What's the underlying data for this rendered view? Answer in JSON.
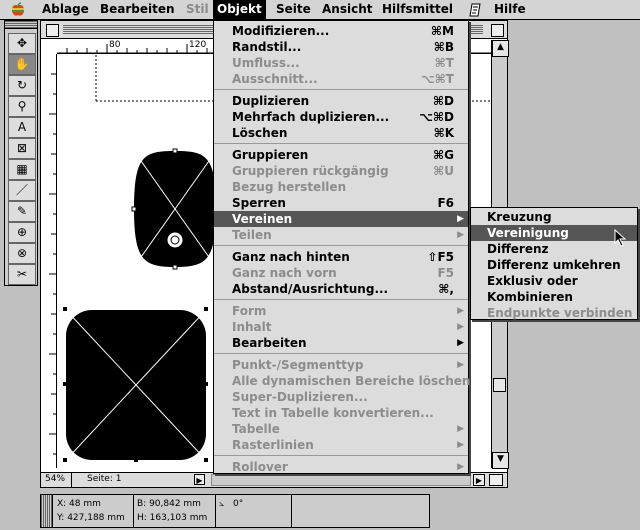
{
  "menubar": {
    "apple": "",
    "items": [
      {
        "label": "Ablage",
        "state": "normal"
      },
      {
        "label": "Bearbeiten",
        "state": "normal"
      },
      {
        "label": "Stil",
        "state": "dim"
      },
      {
        "label": "Objekt",
        "state": "active"
      },
      {
        "label": "Seite",
        "state": "normal"
      },
      {
        "label": "Ansicht",
        "state": "normal"
      },
      {
        "label": "Hilfsmittel",
        "state": "normal"
      },
      {
        "label": "Hilfe",
        "state": "normal"
      }
    ]
  },
  "ruler": {
    "mark1": "80",
    "mark2": "120"
  },
  "status": {
    "zoom": "54%",
    "page": "Seite: 1"
  },
  "objekt_menu": {
    "items": [
      {
        "label": "Modifizieren...",
        "shortcut": "⌘M",
        "dim": false
      },
      {
        "label": "Randstil...",
        "shortcut": "⌘B",
        "dim": false
      },
      {
        "label": "Umfluss...",
        "shortcut": "⌘T",
        "dim": true
      },
      {
        "label": "Ausschnitt...",
        "shortcut": "⌥⌘T",
        "dim": true
      },
      {
        "sep": true
      },
      {
        "label": "Duplizieren",
        "shortcut": "⌘D",
        "dim": false
      },
      {
        "label": "Mehrfach duplizieren...",
        "shortcut": "⌥⌘D",
        "dim": false
      },
      {
        "label": "Löschen",
        "shortcut": "⌘K",
        "dim": false
      },
      {
        "sep": true
      },
      {
        "label": "Gruppieren",
        "shortcut": "⌘G",
        "dim": false
      },
      {
        "label": "Gruppieren rückgängig",
        "shortcut": "⌘U",
        "dim": true
      },
      {
        "label": "Bezug herstellen",
        "shortcut": "",
        "dim": true
      },
      {
        "label": "Sperren",
        "shortcut": "F6",
        "dim": false
      },
      {
        "label": "Vereinen",
        "shortcut": "",
        "dim": false,
        "submenu": true,
        "highlight": true
      },
      {
        "label": "Teilen",
        "shortcut": "",
        "dim": true,
        "submenu": true
      },
      {
        "sep": true
      },
      {
        "label": "Ganz nach hinten",
        "shortcut": "⇧F5",
        "dim": false
      },
      {
        "label": "Ganz nach vorn",
        "shortcut": "F5",
        "dim": true
      },
      {
        "label": "Abstand/Ausrichtung...",
        "shortcut": "⌘,",
        "dim": false
      },
      {
        "sep": true
      },
      {
        "label": "Form",
        "shortcut": "",
        "dim": true,
        "submenu": true
      },
      {
        "label": "Inhalt",
        "shortcut": "",
        "dim": true,
        "submenu": true
      },
      {
        "label": "Bearbeiten",
        "shortcut": "",
        "dim": false,
        "submenu": true
      },
      {
        "sep": true
      },
      {
        "label": "Punkt-/Segmenttyp",
        "shortcut": "",
        "dim": true,
        "submenu": true
      },
      {
        "label": "Alle dynamischen Bereiche löschen",
        "shortcut": "",
        "dim": true
      },
      {
        "label": "Super-Duplizieren...",
        "shortcut": "",
        "dim": true
      },
      {
        "label": "Text in Tabelle konvertieren...",
        "shortcut": "",
        "dim": true
      },
      {
        "label": "Tabelle",
        "shortcut": "",
        "dim": true,
        "submenu": true
      },
      {
        "label": "Rasterlinien",
        "shortcut": "",
        "dim": true,
        "submenu": true
      },
      {
        "sep": true
      },
      {
        "label": "Rollover",
        "shortcut": "",
        "dim": true,
        "submenu": true
      }
    ]
  },
  "vereinen_menu": {
    "items": [
      {
        "label": "Kreuzung",
        "dim": false
      },
      {
        "label": "Vereinigung",
        "dim": false,
        "highlight": true
      },
      {
        "label": "Differenz",
        "dim": false
      },
      {
        "label": "Differenz umkehren",
        "dim": false
      },
      {
        "label": "Exklusiv oder",
        "dim": false
      },
      {
        "label": "Kombinieren",
        "dim": false
      },
      {
        "label": "Endpunkte verbinden",
        "dim": true
      }
    ]
  },
  "info": {
    "x": "X: 48 mm",
    "y": "Y: 427,188 mm",
    "b": "B: 90,842 mm",
    "h": "H: 163,103 mm",
    "angle": "0°"
  },
  "tools": [
    "✥",
    "✋",
    "↻",
    "⚲",
    "A",
    "⊠",
    "▦",
    "／",
    "✎",
    "⊕",
    "⊗",
    "✂"
  ]
}
